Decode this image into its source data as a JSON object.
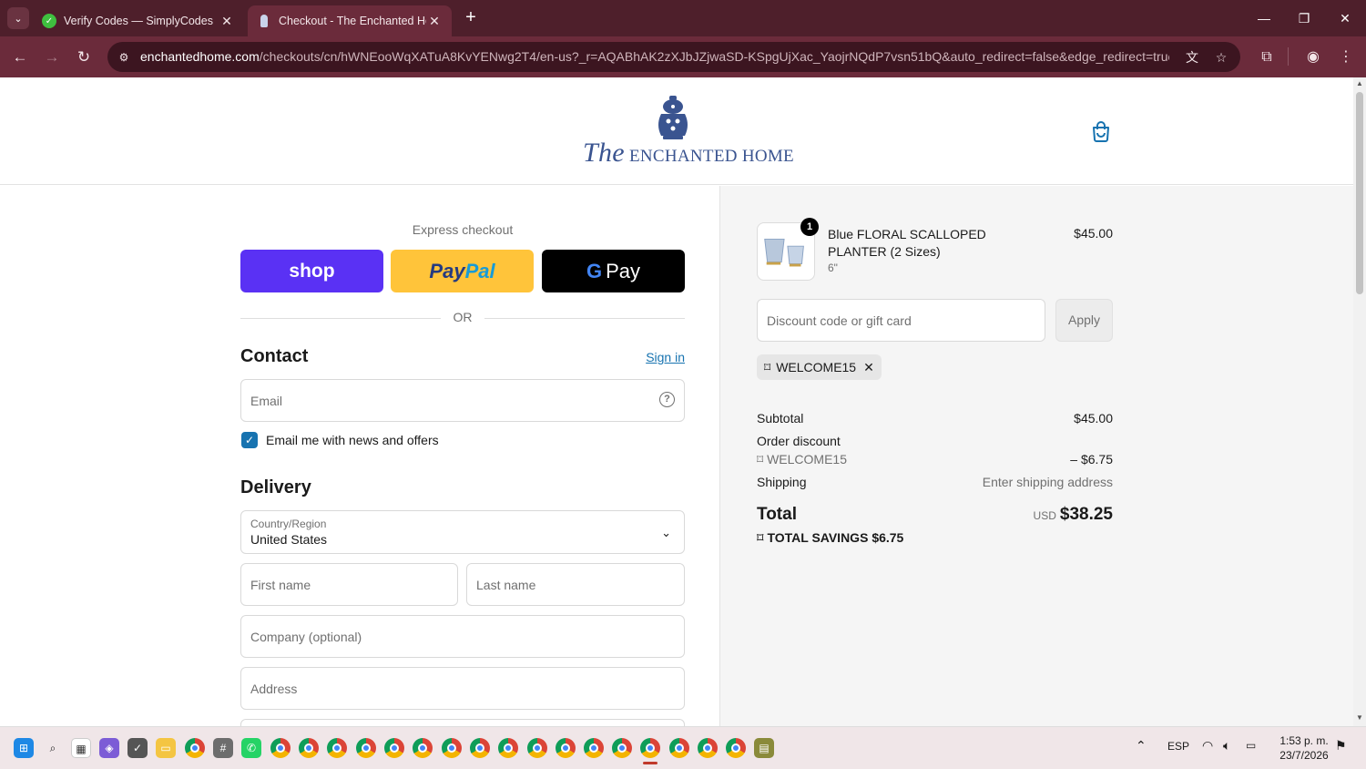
{
  "browser": {
    "tabs": [
      {
        "title": "Verify Codes — SimplyCodes",
        "active": false
      },
      {
        "title": "Checkout - The Enchanted Home",
        "active": true
      }
    ],
    "url_host": "enchantedhome.com",
    "url_path": "/checkouts/cn/hWNEooWqXATuA8KvYENwg2T4/en-us?_r=AQABhAK2zXJbJZjwaSD-KSpgUjXac_YaojrNQdP7vsn51bQ&auto_redirect=false&edge_redirect=true&skip_..."
  },
  "header": {
    "logo_script": "The",
    "logo_text": "ENCHANTED HOME"
  },
  "checkout": {
    "express_label": "Express checkout",
    "shop_label": "shop",
    "paypal_pay": "Pay",
    "paypal_pal": "Pal",
    "gpay_g": "G",
    "gpay_label": "Pay",
    "or_label": "OR",
    "contact_title": "Contact",
    "signin_label": "Sign in",
    "email_placeholder": "Email",
    "news_label": "Email me with news and offers",
    "delivery_title": "Delivery",
    "country_label": "Country/Region",
    "country_value": "United States",
    "first_name_placeholder": "First name",
    "last_name_placeholder": "Last name",
    "company_placeholder": "Company (optional)",
    "address_placeholder": "Address"
  },
  "summary": {
    "item": {
      "qty": "1",
      "name": "Blue FLORAL SCALLOPED PLANTER (2 Sizes)",
      "variant": "6\"",
      "price": "$45.00"
    },
    "discount_placeholder": "Discount code or gift card",
    "apply_label": "Apply",
    "code": "WELCOME15",
    "subtotal_label": "Subtotal",
    "subtotal_value": "$45.00",
    "order_discount_label": "Order discount",
    "discount_code": "WELCOME15",
    "discount_value": "– $6.75",
    "shipping_label": "Shipping",
    "shipping_value": "Enter shipping address",
    "total_label": "Total",
    "total_currency": "USD",
    "total_value": "$38.25",
    "savings_label": "TOTAL SAVINGS",
    "savings_value": "$6.75"
  },
  "taskbar": {
    "lang": "ESP",
    "time": "1:53 p. m.",
    "date": "23/7/2026"
  },
  "colors": {
    "accent": "#1773b0",
    "shop_pay": "#5a31f4",
    "paypal": "#ffc43a",
    "gpay": "#000000",
    "browser_frame": "#4e1f2b"
  }
}
